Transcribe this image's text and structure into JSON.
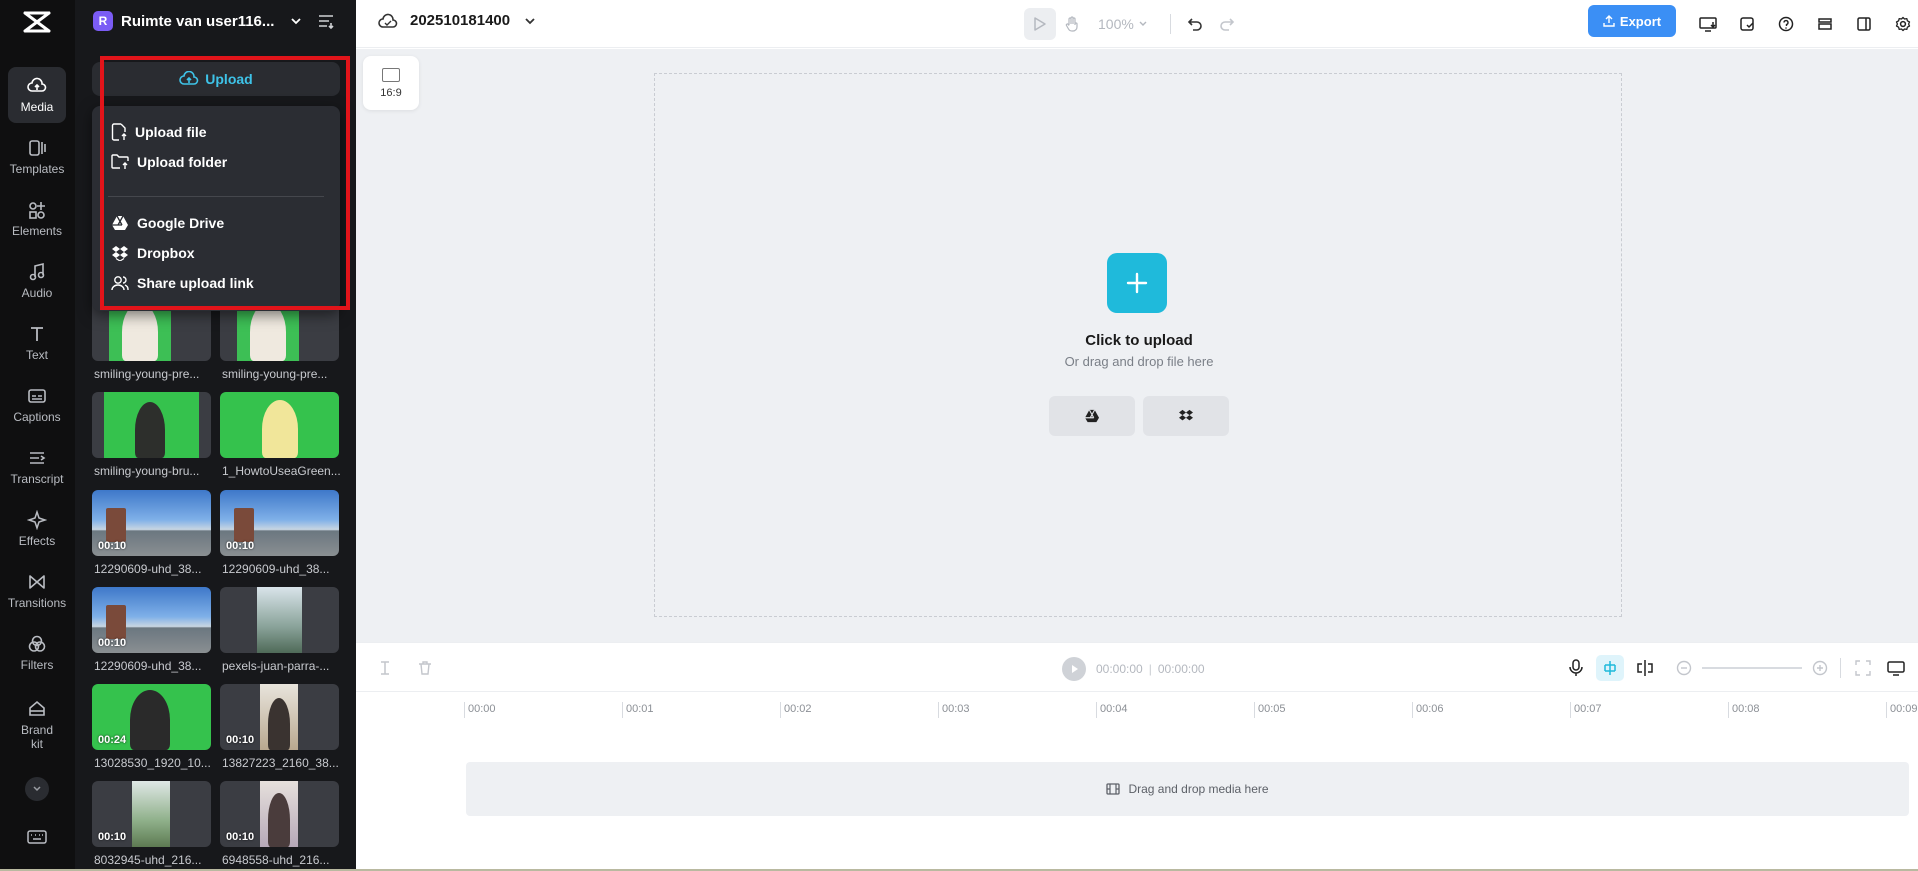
{
  "rail": {
    "items": [
      {
        "label": "Media",
        "icon": "cloud-upload-icon",
        "active": true
      },
      {
        "label": "Templates",
        "icon": "templates-icon"
      },
      {
        "label": "Elements",
        "icon": "elements-icon"
      },
      {
        "label": "Audio",
        "icon": "music-note-icon"
      },
      {
        "label": "Text",
        "icon": "text-icon"
      },
      {
        "label": "Captions",
        "icon": "captions-icon"
      },
      {
        "label": "Transcript",
        "icon": "transcript-icon"
      },
      {
        "label": "Effects",
        "icon": "sparkle-icon"
      },
      {
        "label": "Transitions",
        "icon": "transitions-icon"
      },
      {
        "label": "Filters",
        "icon": "filters-icon"
      },
      {
        "label": "Brand\nkit",
        "icon": "brand-kit-icon"
      }
    ]
  },
  "workspace": {
    "badge": "R",
    "name": "Ruimte van user116..."
  },
  "upload": {
    "button_label": "Upload",
    "menu": [
      "Upload file",
      "Upload folder",
      "Google Drive",
      "Dropbox",
      "Share upload link"
    ]
  },
  "media": [
    {
      "caption": "smiling-young-pre...",
      "duration": ""
    },
    {
      "caption": "smiling-young-pre...",
      "duration": ""
    },
    {
      "caption": "smiling-young-bru...",
      "duration": ""
    },
    {
      "caption": "1_HowtoUseaGreen...",
      "duration": ""
    },
    {
      "caption": "12290609-uhd_38...",
      "duration": "00:10"
    },
    {
      "caption": "12290609-uhd_38...",
      "duration": "00:10"
    },
    {
      "caption": "12290609-uhd_38...",
      "duration": "00:10"
    },
    {
      "caption": "pexels-juan-parra-...",
      "duration": ""
    },
    {
      "caption": "13028530_1920_10...",
      "duration": "00:24"
    },
    {
      "caption": "13827223_2160_38...",
      "duration": "00:10"
    },
    {
      "caption": "8032945-uhd_216...",
      "duration": "00:10"
    },
    {
      "caption": "6948558-uhd_216...",
      "duration": "00:10"
    }
  ],
  "project": {
    "name": "202510181400"
  },
  "toolbar": {
    "zoom": "100%",
    "export_label": "Export"
  },
  "canvas": {
    "ratio_label": "16:9",
    "click_to_upload": "Click to upload",
    "drag_hint": "Or drag and drop file here"
  },
  "timeline": {
    "current_time": "00:00:00",
    "total_time": "00:00:00",
    "ticks": [
      "00:00",
      "00:01",
      "00:02",
      "00:03",
      "00:04",
      "00:05",
      "00:06",
      "00:07",
      "00:08",
      "00:09"
    ],
    "drop_hint": "Drag and drop media here"
  },
  "colors": {
    "accent": "#3b8ff5",
    "upload_accent": "#1fbadb",
    "highlight": "#e2141a",
    "panel_bg": "#17181b",
    "rail_bg": "#0f0f10"
  }
}
